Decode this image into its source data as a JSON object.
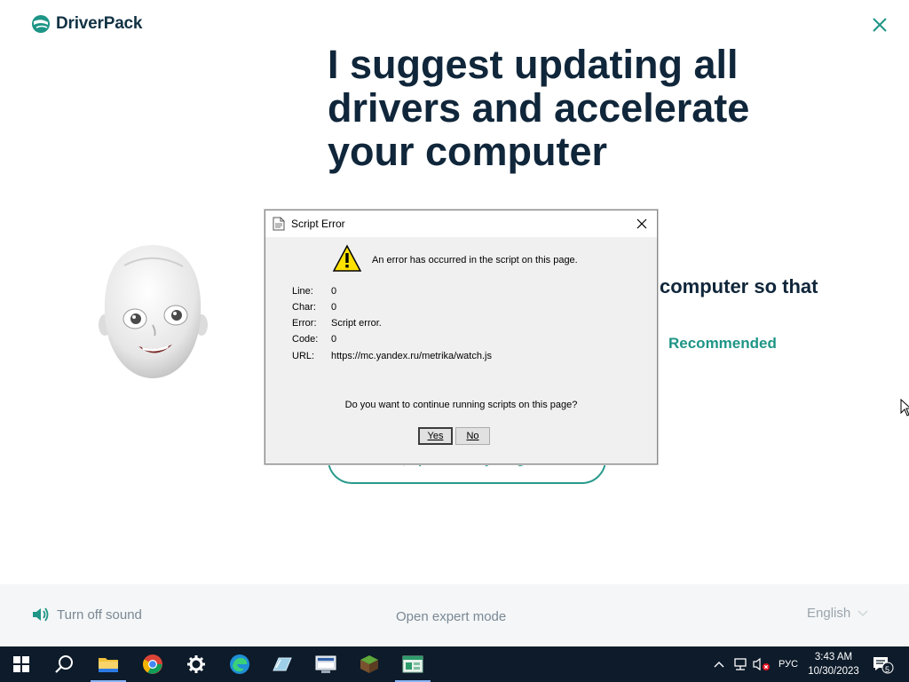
{
  "app": {
    "brand": "DriverPack",
    "headline": "I suggest updating all drivers and accelerate your computer",
    "subline": "computer so that",
    "recommended": "Recommended",
    "ghost_button": "Yes, update everything else",
    "colors": {
      "brand_teal": "#1e9586",
      "heading": "#10263a",
      "muted": "#7b8894"
    }
  },
  "footer": {
    "sound": "Turn off sound",
    "expert": "Open expert mode",
    "language": "English"
  },
  "dialog": {
    "title": "Script Error",
    "message": "An error has occurred in the script on this page.",
    "fields": [
      {
        "key": "Line:",
        "value": "0"
      },
      {
        "key": "Char:",
        "value": "0"
      },
      {
        "key": "Error:",
        "value": "Script error."
      },
      {
        "key": "Code:",
        "value": "0"
      },
      {
        "key": "URL:",
        "value": "https://mc.yandex.ru/metrika/watch.js"
      }
    ],
    "question": "Do you want to continue running scripts on this page?",
    "yes": "Yes",
    "no": "No"
  },
  "taskbar": {
    "items": [
      "start-icon",
      "search-icon",
      "file-explorer-icon",
      "chrome-icon",
      "settings-icon",
      "edge-icon",
      "app-icon",
      "app-icon-2",
      "minecraft-icon",
      "driverpack-taskbar-icon"
    ],
    "language": "РУС",
    "time": "3:43 AM",
    "date": "10/30/2023",
    "notification_count": "5"
  }
}
